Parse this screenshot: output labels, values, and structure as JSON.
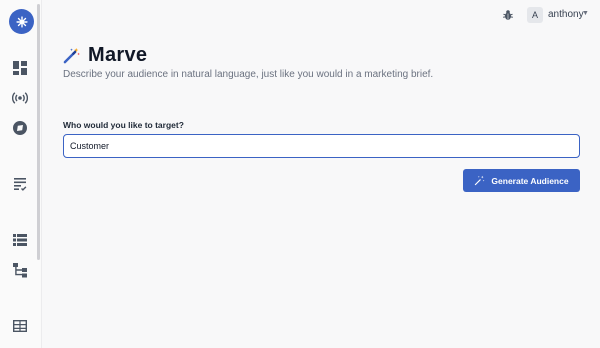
{
  "header": {
    "avatar_initial": "A",
    "username": "anthony"
  },
  "page": {
    "title": "Marve",
    "subtitle": "Describe your audience in natural language, just like you would in a marketing brief."
  },
  "form": {
    "label": "Who would you like to target?",
    "value": "Customer",
    "button_label": "Generate Audience"
  },
  "sidebar": {
    "items": [
      "dashboard-icon",
      "broadcast-icon",
      "compass-icon",
      "checklist-icon",
      "list-icon",
      "hierarchy-icon",
      "table-icon"
    ]
  },
  "colors": {
    "accent": "#3b63c4",
    "background": "#f8f8f9"
  }
}
